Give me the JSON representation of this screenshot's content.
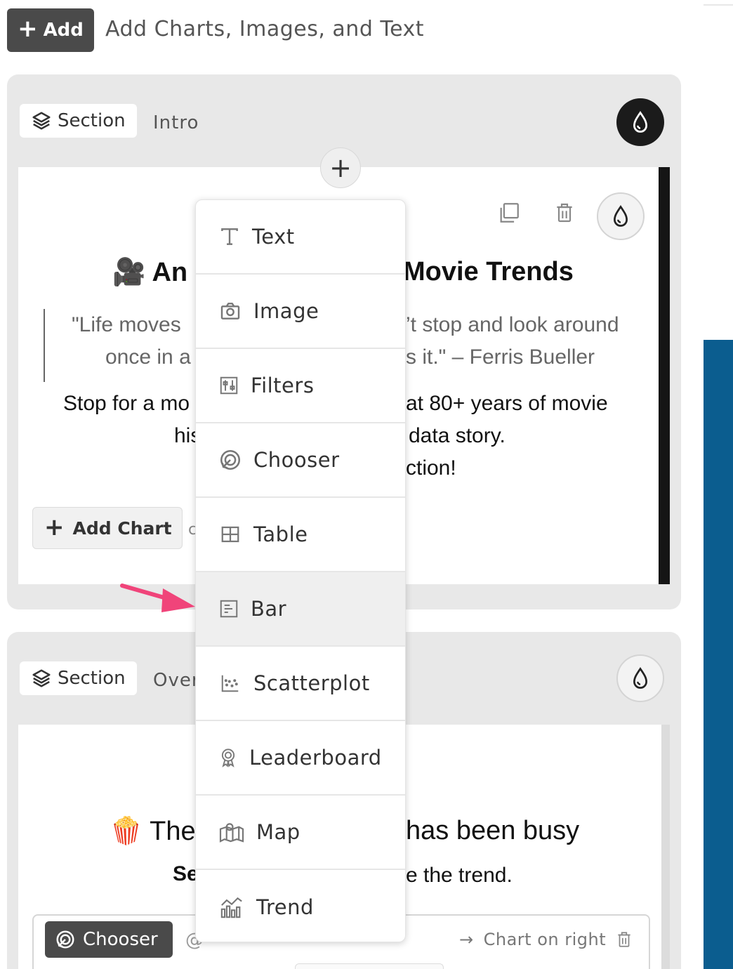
{
  "toolbar": {
    "add_label": "Add",
    "hint": "Add Charts, Images, and Text"
  },
  "section1": {
    "tag_label": "Section",
    "name": "Intro",
    "title_left": "🎥 An I",
    "title_right": "Movie Trends",
    "quote_left_1": "\"Life moves",
    "quote_right_1": "’t stop and look around",
    "quote_left_2": "once in a",
    "quote_right_2": "s it.\" – Ferris Bueller",
    "body_left_1": "Stop for a mo",
    "body_right_1": "at 80+ years of movie",
    "body_left_2": "his",
    "body_right_2": "data story.",
    "body_right_3": "ction!",
    "add_chart_label": "Add Chart",
    "peek_text": "c"
  },
  "section2": {
    "tag_label": "Section",
    "name": "Over",
    "title_left": "🍿 The",
    "title_right": "has been busy",
    "sub_left": "Se",
    "sub_right": "e the trend.",
    "chooser_label": "Chooser",
    "at_symbol": "@",
    "chart_position": "Chart on right"
  },
  "menu": {
    "items": [
      {
        "label": "Text",
        "icon": "text-icon"
      },
      {
        "label": "Image",
        "icon": "camera-icon"
      },
      {
        "label": "Filters",
        "icon": "filters-icon"
      },
      {
        "label": "Chooser",
        "icon": "chooser-icon"
      },
      {
        "label": "Table",
        "icon": "table-icon"
      },
      {
        "label": "Bar",
        "icon": "bar-chart-icon"
      },
      {
        "label": "Scatterplot",
        "icon": "scatterplot-icon"
      },
      {
        "label": "Leaderboard",
        "icon": "award-icon"
      },
      {
        "label": "Map",
        "icon": "map-icon"
      },
      {
        "label": "Trend",
        "icon": "trend-icon"
      }
    ],
    "active": "Bar"
  },
  "colors": {
    "accent_blue": "#0b5d8f",
    "arrow_pink": "#f0447a",
    "dark_button": "#4a4a4a"
  }
}
